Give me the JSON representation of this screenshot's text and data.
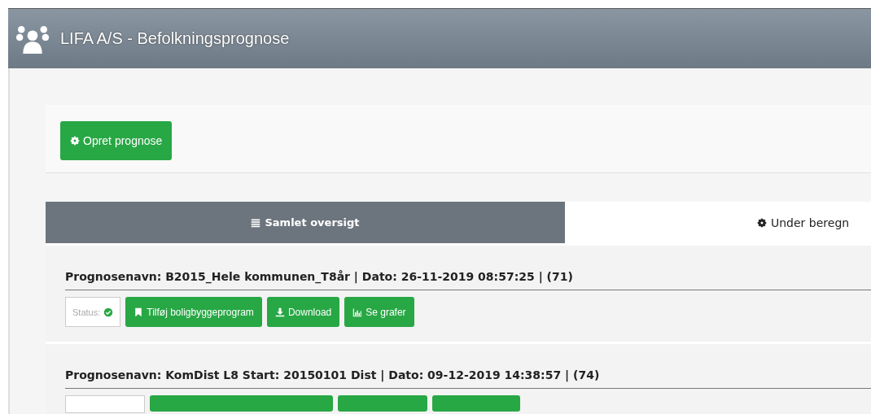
{
  "window": {
    "title": "LIFA A/S - Befolkningsprognose"
  },
  "create_button": {
    "label": "Opret prognose"
  },
  "tabs": [
    {
      "label": "Samlet oversigt",
      "selected": true
    },
    {
      "label": "Under beregn",
      "selected": false
    }
  ],
  "forecasts": [
    {
      "title": "Prognosenavn: B2015_Hele kommunen_T8år | Dato: 26-11-2019 08:57:25 | (71)",
      "status_label": "Status:",
      "status_ok": true,
      "actions": [
        {
          "label": "Tilføj boligbyggeprogram"
        },
        {
          "label": "Download"
        },
        {
          "label": "Se grafer"
        }
      ]
    },
    {
      "title": "Prognosenavn: KomDist L8 Start: 20150101 Dist | Dato: 09-12-2019 14:38:57 | (74)"
    }
  ]
}
